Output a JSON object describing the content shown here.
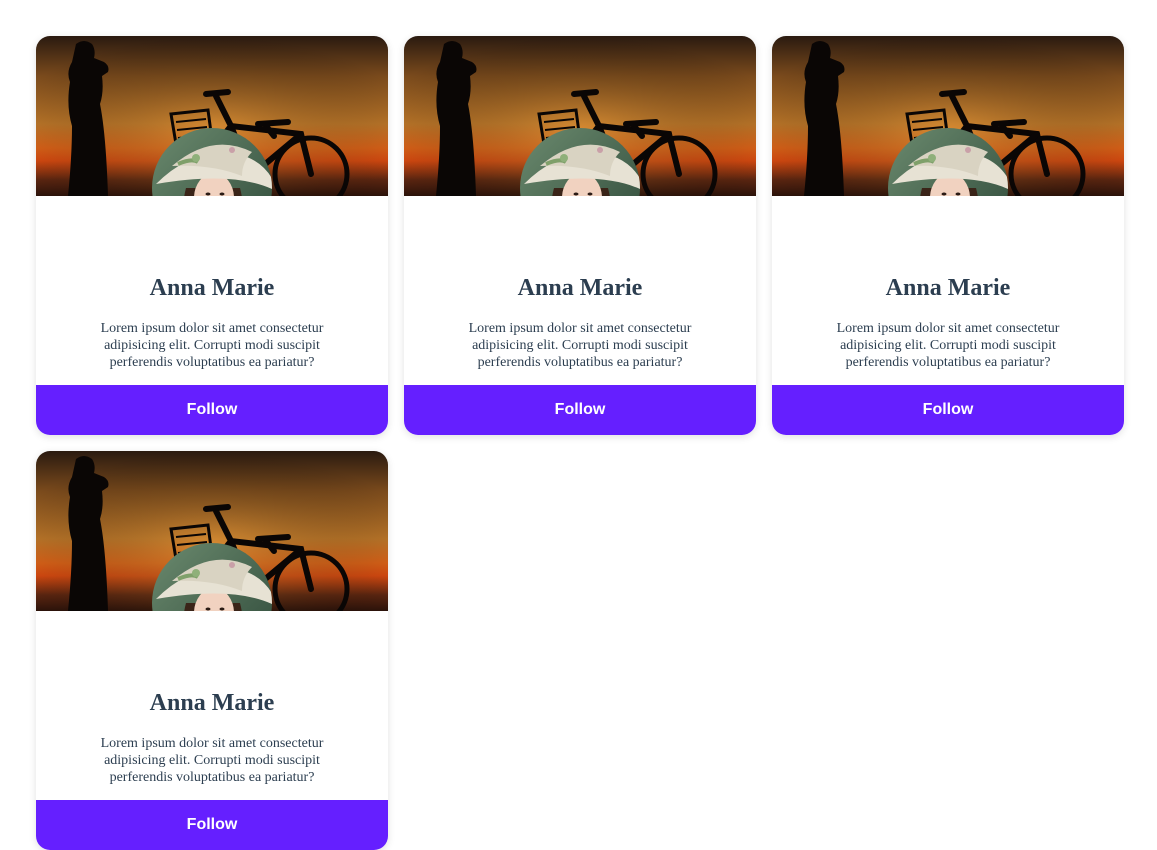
{
  "cards": [
    {
      "name": "Anna Marie",
      "description": "Lorem ipsum dolor sit amet consectetur adipisicing elit. Corrupti modi suscipit perferendis voluptatibus ea pariatur?",
      "follow_label": "Follow",
      "cover_image": "sunset-silhouette-bicycle-image",
      "avatar_image": "woman-sunhat-portrait-image"
    },
    {
      "name": "Anna Marie",
      "description": "Lorem ipsum dolor sit amet consectetur adipisicing elit. Corrupti modi suscipit perferendis voluptatibus ea pariatur?",
      "follow_label": "Follow",
      "cover_image": "sunset-silhouette-bicycle-image",
      "avatar_image": "woman-sunhat-portrait-image"
    },
    {
      "name": "Anna Marie",
      "description": "Lorem ipsum dolor sit amet consectetur adipisicing elit. Corrupti modi suscipit perferendis voluptatibus ea pariatur?",
      "follow_label": "Follow",
      "cover_image": "sunset-silhouette-bicycle-image",
      "avatar_image": "woman-sunhat-portrait-image"
    },
    {
      "name": "Anna Marie",
      "description": "Lorem ipsum dolor sit amet consectetur adipisicing elit. Corrupti modi suscipit perferendis voluptatibus ea pariatur?",
      "follow_label": "Follow",
      "cover_image": "sunset-silhouette-bicycle-image",
      "avatar_image": "woman-sunhat-portrait-image"
    }
  ],
  "colors": {
    "accent": "#651fff",
    "text": "#2c3e50",
    "card_bg": "#ffffff"
  }
}
